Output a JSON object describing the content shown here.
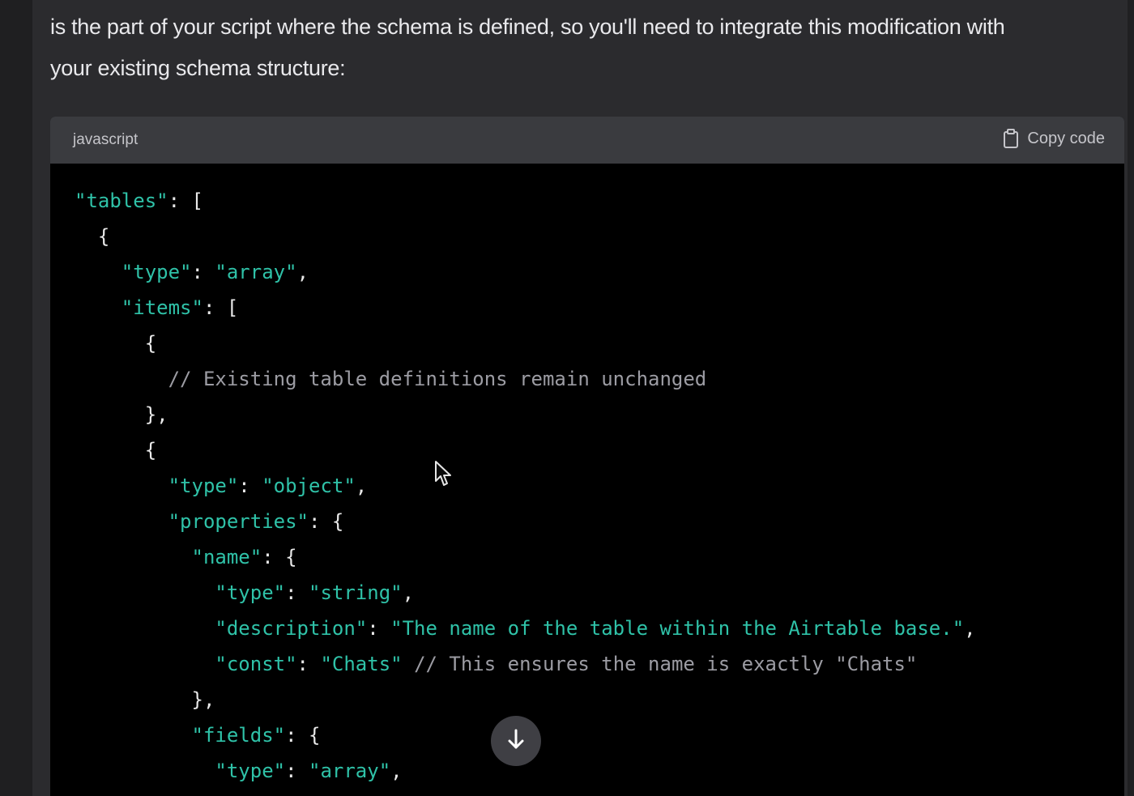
{
  "intro": {
    "line1": "is the part of your script where the schema is defined, so you'll need to integrate this modification with",
    "line2": "your existing schema structure:"
  },
  "code_block": {
    "language": "javascript",
    "copy_label": "Copy code",
    "lines": [
      [
        {
          "t": "k",
          "v": "\"tables\""
        },
        {
          "t": "p",
          "v": ": ["
        }
      ],
      [
        {
          "t": "p",
          "v": "  {"
        }
      ],
      [
        {
          "t": "p",
          "v": "    "
        },
        {
          "t": "k",
          "v": "\"type\""
        },
        {
          "t": "p",
          "v": ": "
        },
        {
          "t": "s",
          "v": "\"array\""
        },
        {
          "t": "p",
          "v": ","
        }
      ],
      [
        {
          "t": "p",
          "v": "    "
        },
        {
          "t": "k",
          "v": "\"items\""
        },
        {
          "t": "p",
          "v": ": ["
        }
      ],
      [
        {
          "t": "p",
          "v": "      {"
        }
      ],
      [
        {
          "t": "p",
          "v": "        "
        },
        {
          "t": "c",
          "v": "// Existing table definitions remain unchanged"
        }
      ],
      [
        {
          "t": "p",
          "v": "      },"
        }
      ],
      [
        {
          "t": "p",
          "v": "      {"
        }
      ],
      [
        {
          "t": "p",
          "v": "        "
        },
        {
          "t": "k",
          "v": "\"type\""
        },
        {
          "t": "p",
          "v": ": "
        },
        {
          "t": "s",
          "v": "\"object\""
        },
        {
          "t": "p",
          "v": ","
        }
      ],
      [
        {
          "t": "p",
          "v": "        "
        },
        {
          "t": "k",
          "v": "\"properties\""
        },
        {
          "t": "p",
          "v": ": {"
        }
      ],
      [
        {
          "t": "p",
          "v": "          "
        },
        {
          "t": "k",
          "v": "\"name\""
        },
        {
          "t": "p",
          "v": ": {"
        }
      ],
      [
        {
          "t": "p",
          "v": "            "
        },
        {
          "t": "k",
          "v": "\"type\""
        },
        {
          "t": "p",
          "v": ": "
        },
        {
          "t": "s",
          "v": "\"string\""
        },
        {
          "t": "p",
          "v": ","
        }
      ],
      [
        {
          "t": "p",
          "v": "            "
        },
        {
          "t": "k",
          "v": "\"description\""
        },
        {
          "t": "p",
          "v": ": "
        },
        {
          "t": "s",
          "v": "\"The name of the table within the Airtable base.\""
        },
        {
          "t": "p",
          "v": ","
        }
      ],
      [
        {
          "t": "p",
          "v": "            "
        },
        {
          "t": "k",
          "v": "\"const\""
        },
        {
          "t": "p",
          "v": ": "
        },
        {
          "t": "s",
          "v": "\"Chats\""
        },
        {
          "t": "p",
          "v": " "
        },
        {
          "t": "c",
          "v": "// This ensures the name is exactly \"Chats\""
        }
      ],
      [
        {
          "t": "p",
          "v": "          },"
        }
      ],
      [
        {
          "t": "p",
          "v": "          "
        },
        {
          "t": "k",
          "v": "\"fields\""
        },
        {
          "t": "p",
          "v": ": {"
        }
      ],
      [
        {
          "t": "p",
          "v": "            "
        },
        {
          "t": "k",
          "v": "\"type\""
        },
        {
          "t": "p",
          "v": ": "
        },
        {
          "t": "s",
          "v": "\"array\""
        },
        {
          "t": "p",
          "v": ","
        }
      ]
    ]
  },
  "icons": {
    "copy": "clipboard-icon",
    "scroll": "arrow-down-icon",
    "cursor": "mouse-pointer-icon"
  },
  "colors": {
    "page_background": "#2b2b2e",
    "code_background": "#000000",
    "header_background": "#3a3b3f",
    "key_string": "#2fc2a8",
    "comment": "#9c9ca3"
  }
}
